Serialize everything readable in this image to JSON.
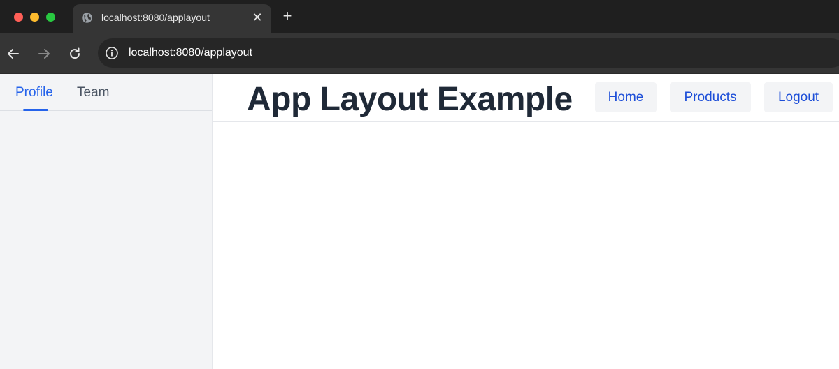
{
  "browser": {
    "tab": {
      "title": "localhost:8080/applayout",
      "icon": "globe-icon"
    },
    "address_bar": {
      "url": "localhost:8080/applayout"
    },
    "colors": {
      "chrome_dark": "#1f1f1f",
      "chrome_tab": "#353535",
      "close": "#ff5f57",
      "minimize": "#febc2e",
      "maximize": "#28c840"
    }
  },
  "sidebar": {
    "tabs": [
      {
        "label": "Profile",
        "selected": true
      },
      {
        "label": "Team",
        "selected": false
      }
    ]
  },
  "header": {
    "title": "App Layout Example",
    "nav": [
      {
        "label": "Home"
      },
      {
        "label": "Products"
      },
      {
        "label": "Logout"
      }
    ]
  },
  "colors": {
    "accent": "#2563eb",
    "link": "#1d4ed8",
    "title": "#1f2937",
    "sidebar_bg": "#f3f4f6",
    "nav_bg": "#f3f4f6"
  }
}
